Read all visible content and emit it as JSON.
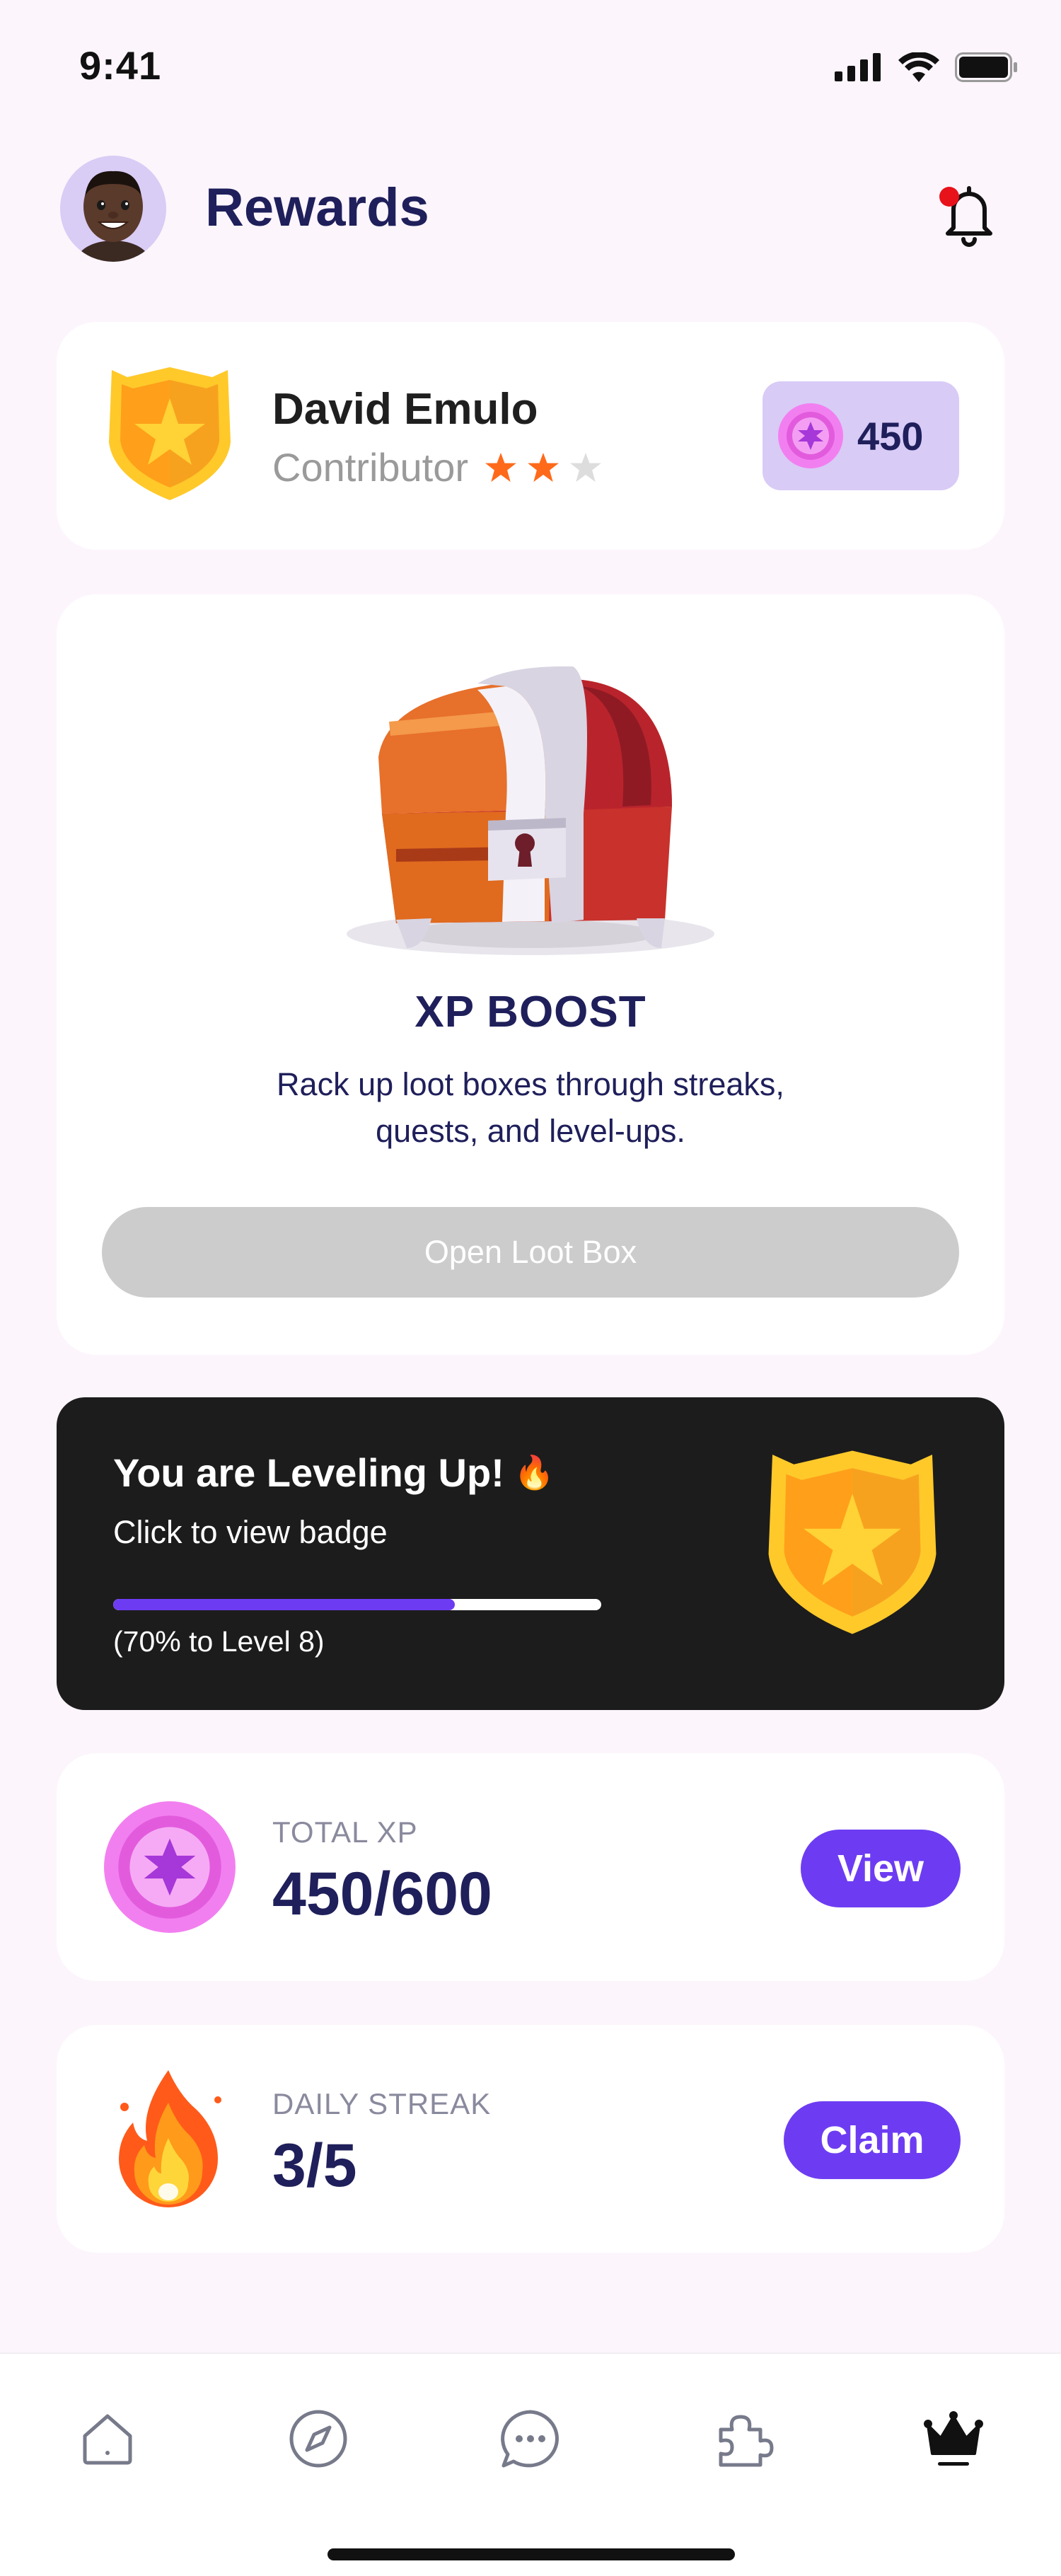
{
  "status_bar": {
    "time": "9:41"
  },
  "header": {
    "title": "Rewards",
    "notification_dot": true
  },
  "profile": {
    "name": "David Emulo",
    "role": "Contributor",
    "rating": 2,
    "rating_max": 3,
    "xp_points": "450"
  },
  "loot": {
    "title": "XP BOOST",
    "description": "Rack up loot boxes through streaks, quests, and level-ups.",
    "button_label": "Open Loot Box",
    "button_disabled": true
  },
  "level": {
    "title": "You are Leveling Up!",
    "title_emoji": "🔥",
    "subtitle": "Click to view badge",
    "progress": 0.7,
    "note": "(70% to Level 8)"
  },
  "total_xp": {
    "label": "TOTAL XP",
    "value": "450/600",
    "button_label": "View"
  },
  "daily_streak": {
    "label": "DAILY STREAK",
    "value": "3/5",
    "button_label": "Claim"
  },
  "bottom_nav": {
    "items": [
      {
        "icon": "home-icon",
        "active": false
      },
      {
        "icon": "compass-icon",
        "active": false
      },
      {
        "icon": "chat-icon",
        "active": false
      },
      {
        "icon": "puzzle-icon",
        "active": false
      },
      {
        "icon": "crown-icon",
        "active": true
      }
    ]
  },
  "colors": {
    "background": "#fcf5fc",
    "accent": "#6d3cf2",
    "title": "#1f1f5b",
    "dark_card": "#1c1c1c",
    "badge_bg": "#d8cbf6",
    "star_active": "#ff6a1a",
    "star_inactive": "#dddddd"
  }
}
